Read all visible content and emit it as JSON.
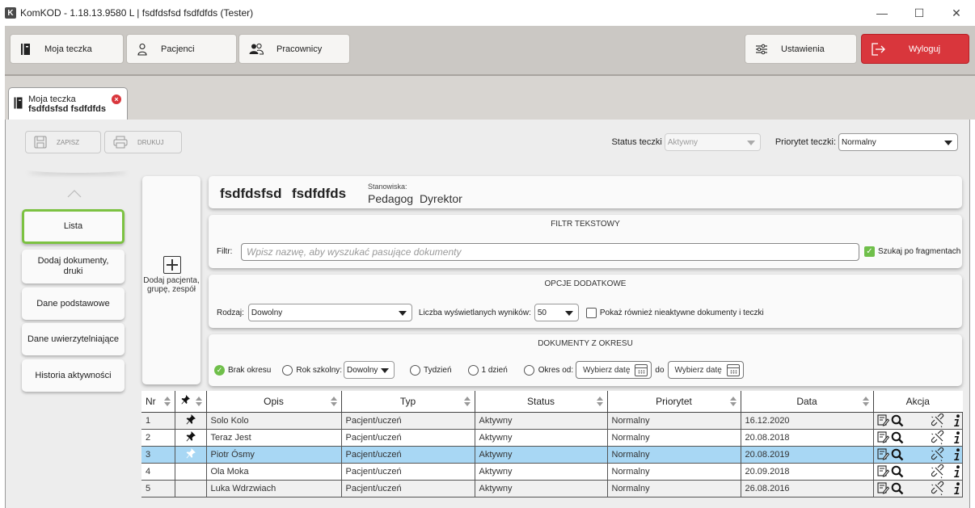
{
  "window": {
    "logo": "K",
    "title": "KomKOD - 1.18.13.9580 L | fsdfdsfsd fsdfdfds (Tester)",
    "min": "—",
    "max": "☐",
    "close": "✕"
  },
  "nav": {
    "moja_teczka": "Moja teczka",
    "pacjenci": "Pacjenci",
    "pracownicy": "Pracownicy",
    "ustawienia": "Ustawienia",
    "wyloguj": "Wyloguj"
  },
  "tab": {
    "line1": "Moja teczka",
    "line2": "fsdfdsfsd fsdfdfds",
    "close": "×"
  },
  "toolbar": {
    "zapisz": "ZAPISZ",
    "drukuj": "DRUKUJ",
    "status_label": "Status teczki",
    "status_value": "Aktywny",
    "priorytet_label": "Priorytet teczki:",
    "priorytet_value": "Normalny"
  },
  "menu": {
    "lista": "Lista",
    "dodaj_dokumenty": "Dodaj dokumenty, druki",
    "dane_podstawowe": "Dane podstawowe",
    "dane_uwierzytelniajace": "Dane uwierzytelniające",
    "historia": "Historia aktywności"
  },
  "add_card": {
    "label": "Dodaj pacjenta, grupę, zespół"
  },
  "person": {
    "first_name": "fsdfdsfsd",
    "last_name": "fsdfdfds",
    "stanowiska_label": "Stanowiska:",
    "stanowiska_value": "Pedagog Dyrektor"
  },
  "filter": {
    "title": "FILTR TEKSTOWY",
    "label": "Filtr:",
    "placeholder": "Wpisz nazwę, aby wyszukać pasujące dokumenty",
    "fragment_label": "Szukaj po fragmentach"
  },
  "options": {
    "title": "OPCJE DODATKOWE",
    "rodzaj_label": "Rodzaj:",
    "rodzaj_value": "Dowolny",
    "liczba_label": "Liczba wyświetlanych wyników:",
    "liczba_value": "50",
    "inactive_label": "Pokaż również nieaktywne dokumenty i teczki"
  },
  "period": {
    "title": "DOKUMENTY Z OKRESU",
    "brak_okresu": "Brak okresu",
    "rok_szkolny": "Rok szkolny:",
    "rok_value": "Dowolny",
    "tydzien": "Tydzień",
    "jeden_dzien": "1 dzień",
    "okres_od": "Okres od:",
    "wybierz_od": "Wybierz datę",
    "do": "do",
    "wybierz_do": "Wybierz datę"
  },
  "table": {
    "headers": {
      "nr": "Nr",
      "opis": "Opis",
      "typ": "Typ",
      "status": "Status",
      "priorytet": "Priorytet",
      "data": "Data",
      "akcja": "Akcja"
    },
    "rows": [
      {
        "nr": "1",
        "pinned": true,
        "opis": "Solo Kolo",
        "typ": "Pacjent/uczeń",
        "status": "Aktywny",
        "priorytet": "Normalny",
        "data": "16.12.2020"
      },
      {
        "nr": "2",
        "pinned": true,
        "opis": "Teraz Jest",
        "typ": "Pacjent/uczeń",
        "status": "Aktywny",
        "priorytet": "Normalny",
        "data": "20.08.2018"
      },
      {
        "nr": "3",
        "pinned": true,
        "opis": "Piotr Ósmy",
        "typ": "Pacjent/uczeń",
        "status": "Aktywny",
        "priorytet": "Normalny",
        "data": "20.08.2019",
        "selected": true
      },
      {
        "nr": "4",
        "pinned": false,
        "opis": "Ola Moka",
        "typ": "Pacjent/uczeń",
        "status": "Aktywny",
        "priorytet": "Normalny",
        "data": "20.09.2018"
      },
      {
        "nr": "5",
        "pinned": false,
        "opis": "Luka Wdrzwiach",
        "typ": "Pacjent/uczeń",
        "status": "Aktywny",
        "priorytet": "Normalny",
        "data": "26.08.2016"
      }
    ]
  },
  "colors": {
    "accent_green": "#7cc242",
    "logout_red": "#d9363c",
    "selected_row": "#a8d7f4"
  }
}
